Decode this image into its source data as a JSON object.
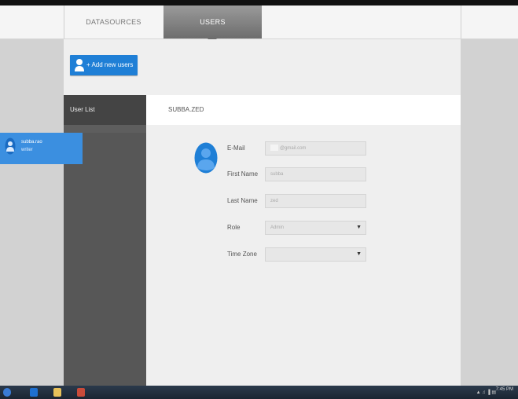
{
  "header": {
    "tabs": [
      {
        "label": "DATASOURCES"
      },
      {
        "label": "USERS"
      }
    ]
  },
  "toolbar": {
    "add_users_label": "+ Add new users"
  },
  "sidebar": {
    "title": "User List",
    "users": [
      {
        "name": "subba.rao",
        "role": "writer"
      }
    ]
  },
  "detail": {
    "header_title": "SUBBA.ZED",
    "fields": {
      "email": {
        "label": "E-Mail",
        "value": "@gmail.com"
      },
      "first_name": {
        "label": "First Name",
        "value": "subba"
      },
      "last_name": {
        "label": "Last Name",
        "value": "zed"
      },
      "role": {
        "label": "Role",
        "value": "Admin"
      },
      "time_zone": {
        "label": "Time Zone",
        "value": ""
      }
    }
  },
  "taskbar": {
    "clock": "7:45 PM",
    "tray": "▲ ♫ ▐ ▤"
  },
  "colors": {
    "accent": "#1f7fd6",
    "selected_user": "#3b8fe0",
    "sidebar_bg": "#575757"
  }
}
